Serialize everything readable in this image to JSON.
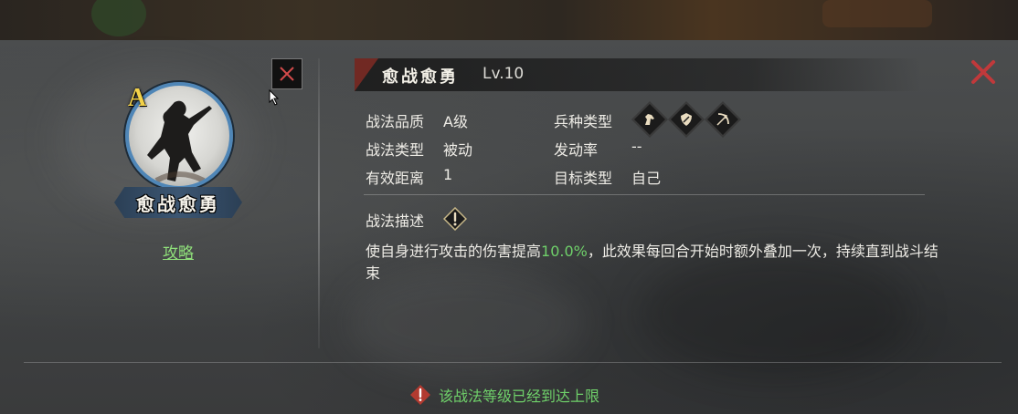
{
  "skill": {
    "grade_badge": "A",
    "name": "愈战愈勇",
    "nameplate": "愈战愈勇",
    "level": "Lv.10",
    "guide_link": "攻略"
  },
  "stats": {
    "quality_label": "战法品质",
    "quality_value": "A级",
    "type_label": "战法类型",
    "type_value": "被动",
    "range_label": "有效距离",
    "range_value": "1",
    "unit_label": "兵种类型",
    "unit_icons": [
      "cavalry-icon",
      "shield-icon",
      "bow-icon"
    ],
    "trigger_label": "发动率",
    "trigger_value": "--",
    "target_label": "目标类型",
    "target_value": "自己"
  },
  "description": {
    "title": "战法描述",
    "before": "使自身进行攻击的伤害提高",
    "highlight": "10.0%",
    "after": "，此效果每回合开始时额外叠加一次，持续直到战斗结束"
  },
  "notice": "该战法等级已经到达上限",
  "colors": {
    "highlight_green": "#6fd06a",
    "grade_gold": "#f3d24a",
    "close_red": "#c0393b",
    "ring_blue": "#4f86b7"
  }
}
